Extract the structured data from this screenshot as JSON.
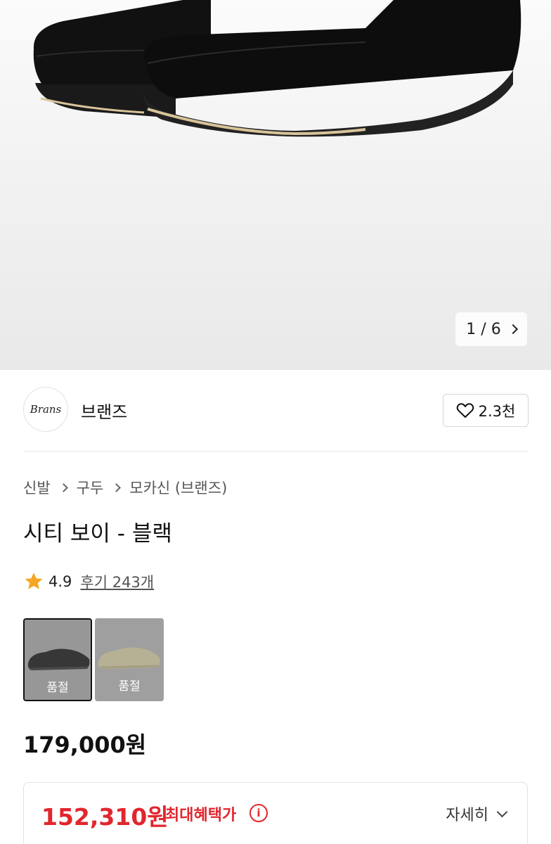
{
  "gallery": {
    "current": "1",
    "separator": "/",
    "total": "6",
    "next_icon": "chevron-right-icon"
  },
  "brand": {
    "logo_text": "Brans",
    "name": "브랜즈",
    "like_icon": "heart-icon",
    "like_count": "2.3천"
  },
  "breadcrumb": [
    "신발",
    "구두",
    "모카신 (브랜즈)"
  ],
  "product": {
    "title": "시티 보이 - 블랙",
    "rating": "4.9",
    "reviews": "후기 243개",
    "star_color": "#f5a623"
  },
  "options": [
    {
      "status": "품절",
      "selected": true
    },
    {
      "status": "품절",
      "selected": false
    }
  ],
  "price": {
    "original": "179,000원"
  },
  "benefit": {
    "price": "152,310원",
    "label": "최대혜택가",
    "info_icon": "info-icon",
    "detail_label": "자세히",
    "accent_color": "#e1262d"
  }
}
